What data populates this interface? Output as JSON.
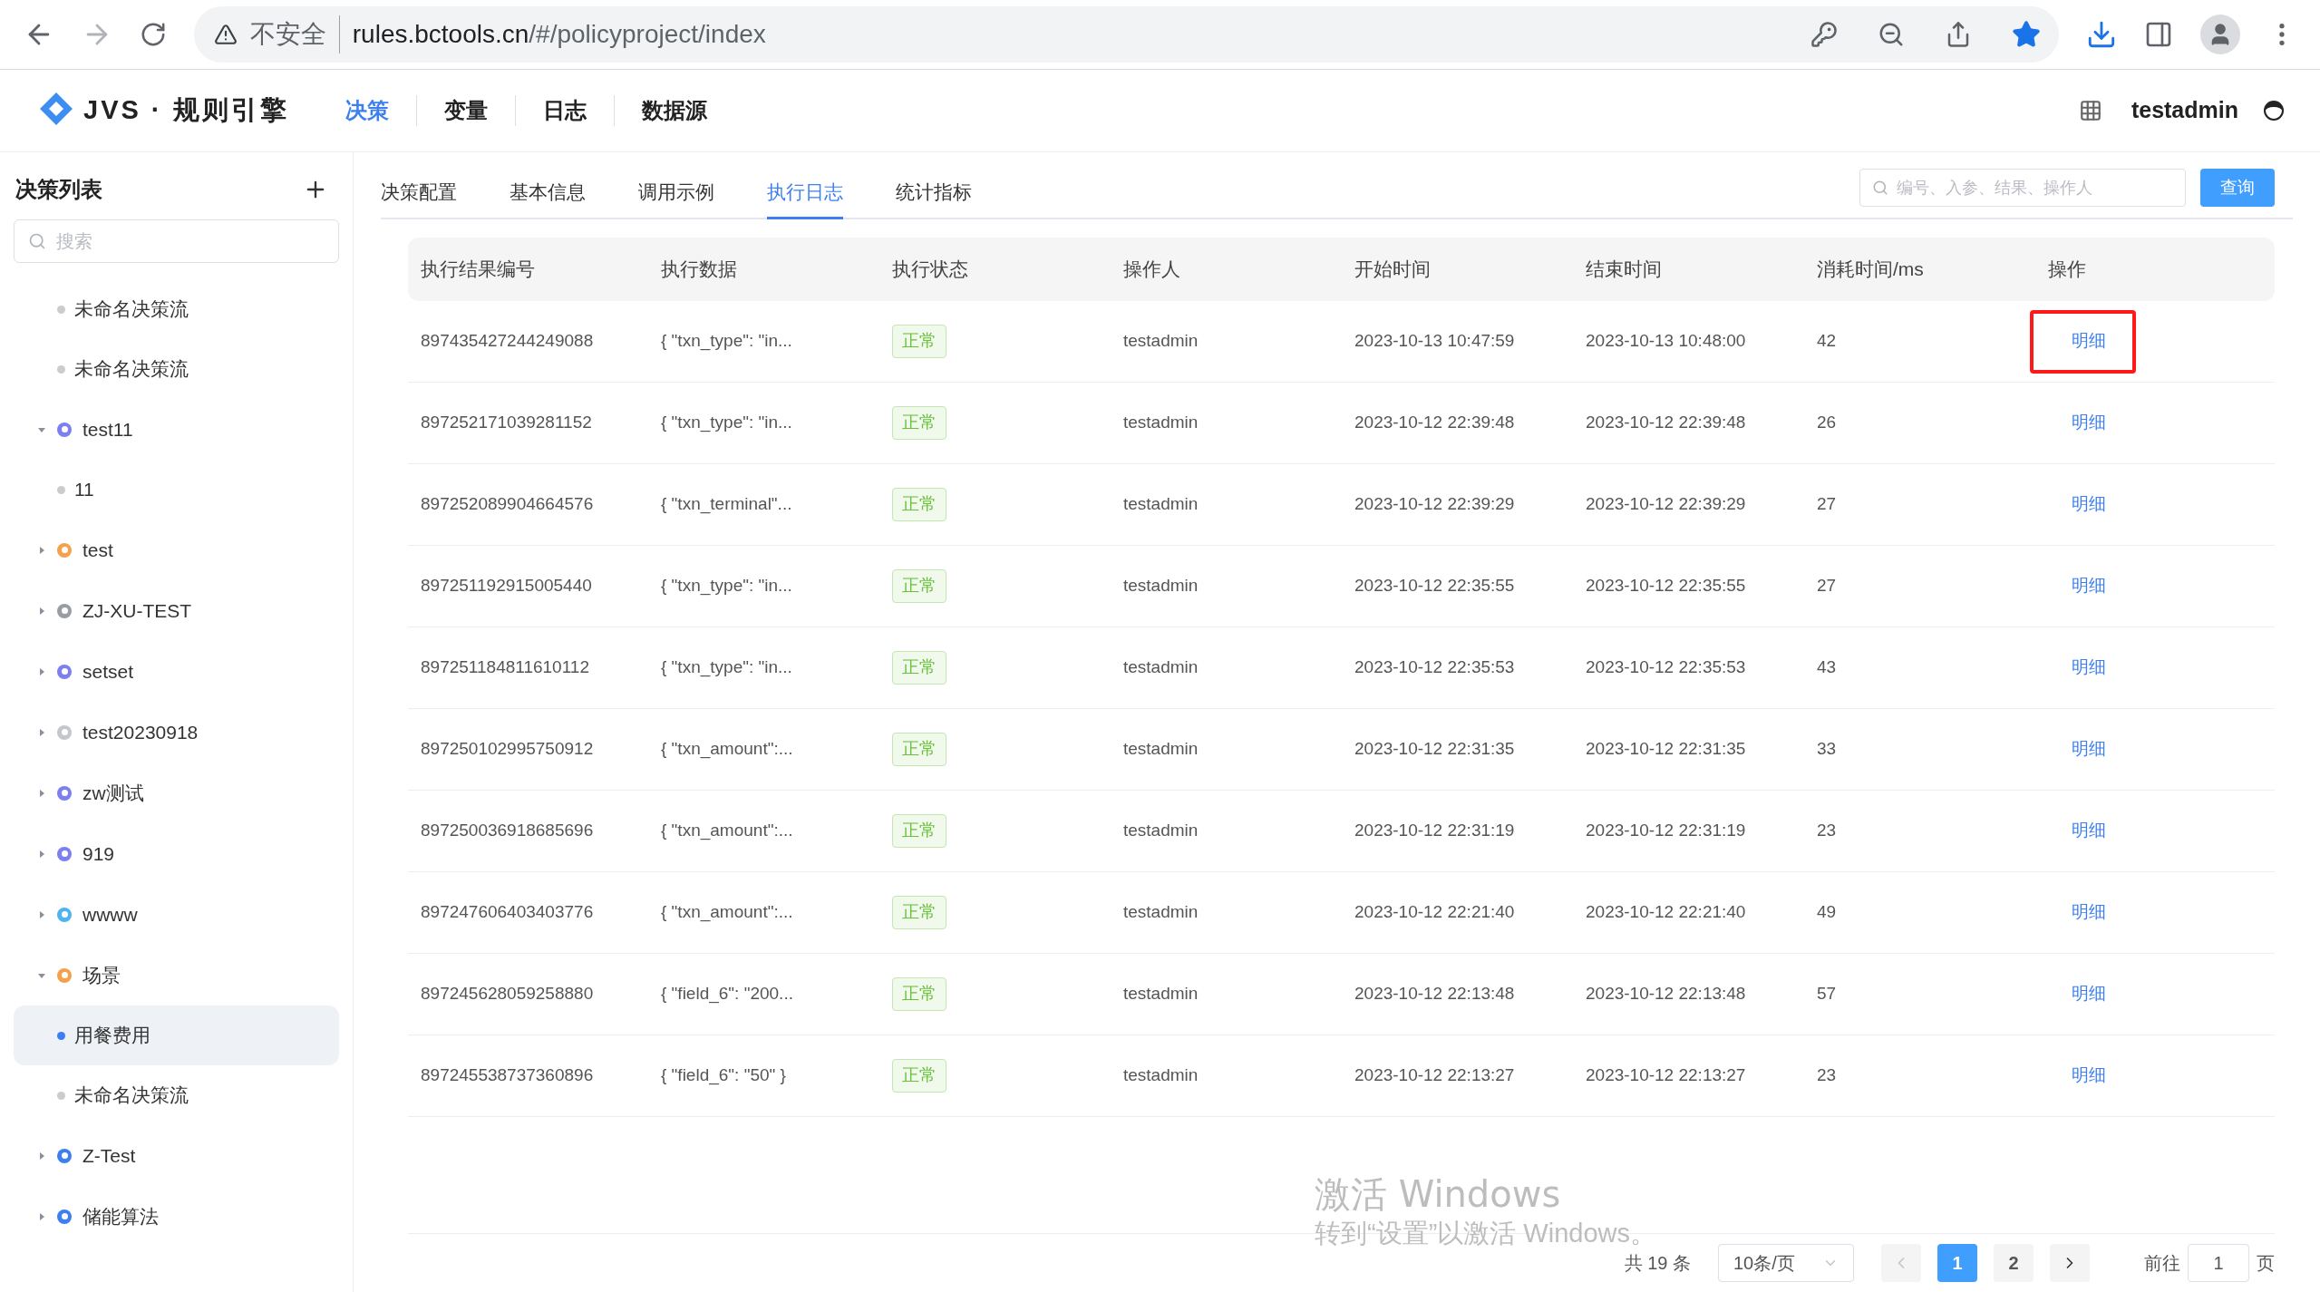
{
  "browser": {
    "security_label": "不安全",
    "url_host": "rules.bctools.cn",
    "url_path": "/#/policyproject/index"
  },
  "app_header": {
    "logo_text": "JVS · 规则引擎",
    "nav": [
      {
        "label": "决策",
        "selected": true
      },
      {
        "label": "变量",
        "selected": false
      },
      {
        "label": "日志",
        "selected": false
      },
      {
        "label": "数据源",
        "selected": false
      }
    ],
    "username": "testadmin"
  },
  "sidebar": {
    "title": "决策列表",
    "search": {
      "placeholder": "搜索"
    },
    "items": [
      {
        "label": "未命名决策流",
        "kind": "leaf",
        "selected": false
      },
      {
        "label": "未命名决策流",
        "kind": "leaf",
        "selected": false
      },
      {
        "label": "test11",
        "kind": "group",
        "color": "#7b7ff0",
        "expanded": true,
        "children": [
          {
            "label": "11",
            "kind": "leaf",
            "selected": false
          }
        ]
      },
      {
        "label": "test",
        "kind": "group",
        "color": "#f5a04a",
        "expanded": false
      },
      {
        "label": "ZJ-XU-TEST",
        "kind": "group",
        "color": "#9a9ca3",
        "expanded": false
      },
      {
        "label": "setset",
        "kind": "group",
        "color": "#7b7ff0",
        "expanded": false
      },
      {
        "label": "test20230918",
        "kind": "group",
        "color": "#c4c6cc",
        "expanded": false
      },
      {
        "label": "zw测试",
        "kind": "group",
        "color": "#7b7ff0",
        "expanded": false
      },
      {
        "label": "919",
        "kind": "group",
        "color": "#7b7ff0",
        "expanded": false
      },
      {
        "label": "wwww",
        "kind": "group",
        "color": "#4fb3f0",
        "expanded": false
      },
      {
        "label": "场景",
        "kind": "group",
        "color": "#f5a04a",
        "expanded": true,
        "children": [
          {
            "label": "用餐费用",
            "kind": "leaf",
            "selected": true
          },
          {
            "label": "未命名决策流",
            "kind": "leaf",
            "selected": false
          }
        ]
      },
      {
        "label": "Z-Test",
        "kind": "group",
        "color": "#3d7ff0",
        "expanded": false
      },
      {
        "label": "储能算法",
        "kind": "group",
        "color": "#3d7ff0",
        "expanded": false
      }
    ]
  },
  "tabs": [
    {
      "label": "决策配置",
      "selected": false
    },
    {
      "label": "基本信息",
      "selected": false
    },
    {
      "label": "调用示例",
      "selected": false
    },
    {
      "label": "执行日志",
      "selected": true
    },
    {
      "label": "统计指标",
      "selected": false
    }
  ],
  "log_search": {
    "placeholder": "编号、入参、结果、操作人",
    "button": "查询"
  },
  "table": {
    "columns": [
      "执行结果编号",
      "执行数据",
      "执行状态",
      "操作人",
      "开始时间",
      "结束时间",
      "消耗时间/ms",
      "操作"
    ],
    "rows": [
      {
        "id": "897435427244249088",
        "data": "{ \"txn_type\": \"in...",
        "status": {
          "text": "正常",
          "kind": "success"
        },
        "operator": "testadmin",
        "start": "2023-10-13 10:47:59",
        "end": "2023-10-13 10:48:00",
        "duration": "42",
        "action": "明细",
        "highlighted": true
      },
      {
        "id": "897252171039281152",
        "data": "{ \"txn_type\": \"in...",
        "status": {
          "text": "正常",
          "kind": "success"
        },
        "operator": "testadmin",
        "start": "2023-10-12 22:39:48",
        "end": "2023-10-12 22:39:48",
        "duration": "26",
        "action": "明细",
        "highlighted": false
      },
      {
        "id": "897252089904664576",
        "data": "{ \"txn_terminal\"...",
        "status": {
          "text": "正常",
          "kind": "success"
        },
        "operator": "testadmin",
        "start": "2023-10-12 22:39:29",
        "end": "2023-10-12 22:39:29",
        "duration": "27",
        "action": "明细",
        "highlighted": false
      },
      {
        "id": "897251192915005440",
        "data": "{ \"txn_type\": \"in...",
        "status": {
          "text": "正常",
          "kind": "success"
        },
        "operator": "testadmin",
        "start": "2023-10-12 22:35:55",
        "end": "2023-10-12 22:35:55",
        "duration": "27",
        "action": "明细",
        "highlighted": false
      },
      {
        "id": "897251184811610112",
        "data": "{ \"txn_type\": \"in...",
        "status": {
          "text": "正常",
          "kind": "success"
        },
        "operator": "testadmin",
        "start": "2023-10-12 22:35:53",
        "end": "2023-10-12 22:35:53",
        "duration": "43",
        "action": "明细",
        "highlighted": false
      },
      {
        "id": "897250102995750912",
        "data": "{ \"txn_amount\":...",
        "status": {
          "text": "正常",
          "kind": "success"
        },
        "operator": "testadmin",
        "start": "2023-10-12 22:31:35",
        "end": "2023-10-12 22:31:35",
        "duration": "33",
        "action": "明细",
        "highlighted": false
      },
      {
        "id": "897250036918685696",
        "data": "{ \"txn_amount\":...",
        "status": {
          "text": "正常",
          "kind": "success"
        },
        "operator": "testadmin",
        "start": "2023-10-12 22:31:19",
        "end": "2023-10-12 22:31:19",
        "duration": "23",
        "action": "明细",
        "highlighted": false
      },
      {
        "id": "897247606403403776",
        "data": "{ \"txn_amount\":...",
        "status": {
          "text": "正常",
          "kind": "success"
        },
        "operator": "testadmin",
        "start": "2023-10-12 22:21:40",
        "end": "2023-10-12 22:21:40",
        "duration": "49",
        "action": "明细",
        "highlighted": false
      },
      {
        "id": "897245628059258880",
        "data": "{ \"field_6\": \"200...",
        "status": {
          "text": "正常",
          "kind": "success"
        },
        "operator": "testadmin",
        "start": "2023-10-12 22:13:48",
        "end": "2023-10-12 22:13:48",
        "duration": "57",
        "action": "明细",
        "highlighted": false
      },
      {
        "id": "897245538737360896",
        "data": "{ \"field_6\": \"50\" }",
        "status": {
          "text": "正常",
          "kind": "success"
        },
        "operator": "testadmin",
        "start": "2023-10-12 22:13:27",
        "end": "2023-10-12 22:13:27",
        "duration": "23",
        "action": "明细",
        "highlighted": false
      }
    ]
  },
  "pagination": {
    "total": "共 19 条",
    "page_size": "10条/页",
    "prev_disabled": true,
    "next_disabled": false,
    "pages": [
      {
        "label": "1",
        "selected": true
      },
      {
        "label": "2",
        "selected": false
      }
    ],
    "goto_label": "前往",
    "goto_value": "1",
    "goto_suffix": "页"
  },
  "os_notice": {
    "title": "激活 Windows",
    "text": "转到“设置”以激活 Windows。"
  }
}
